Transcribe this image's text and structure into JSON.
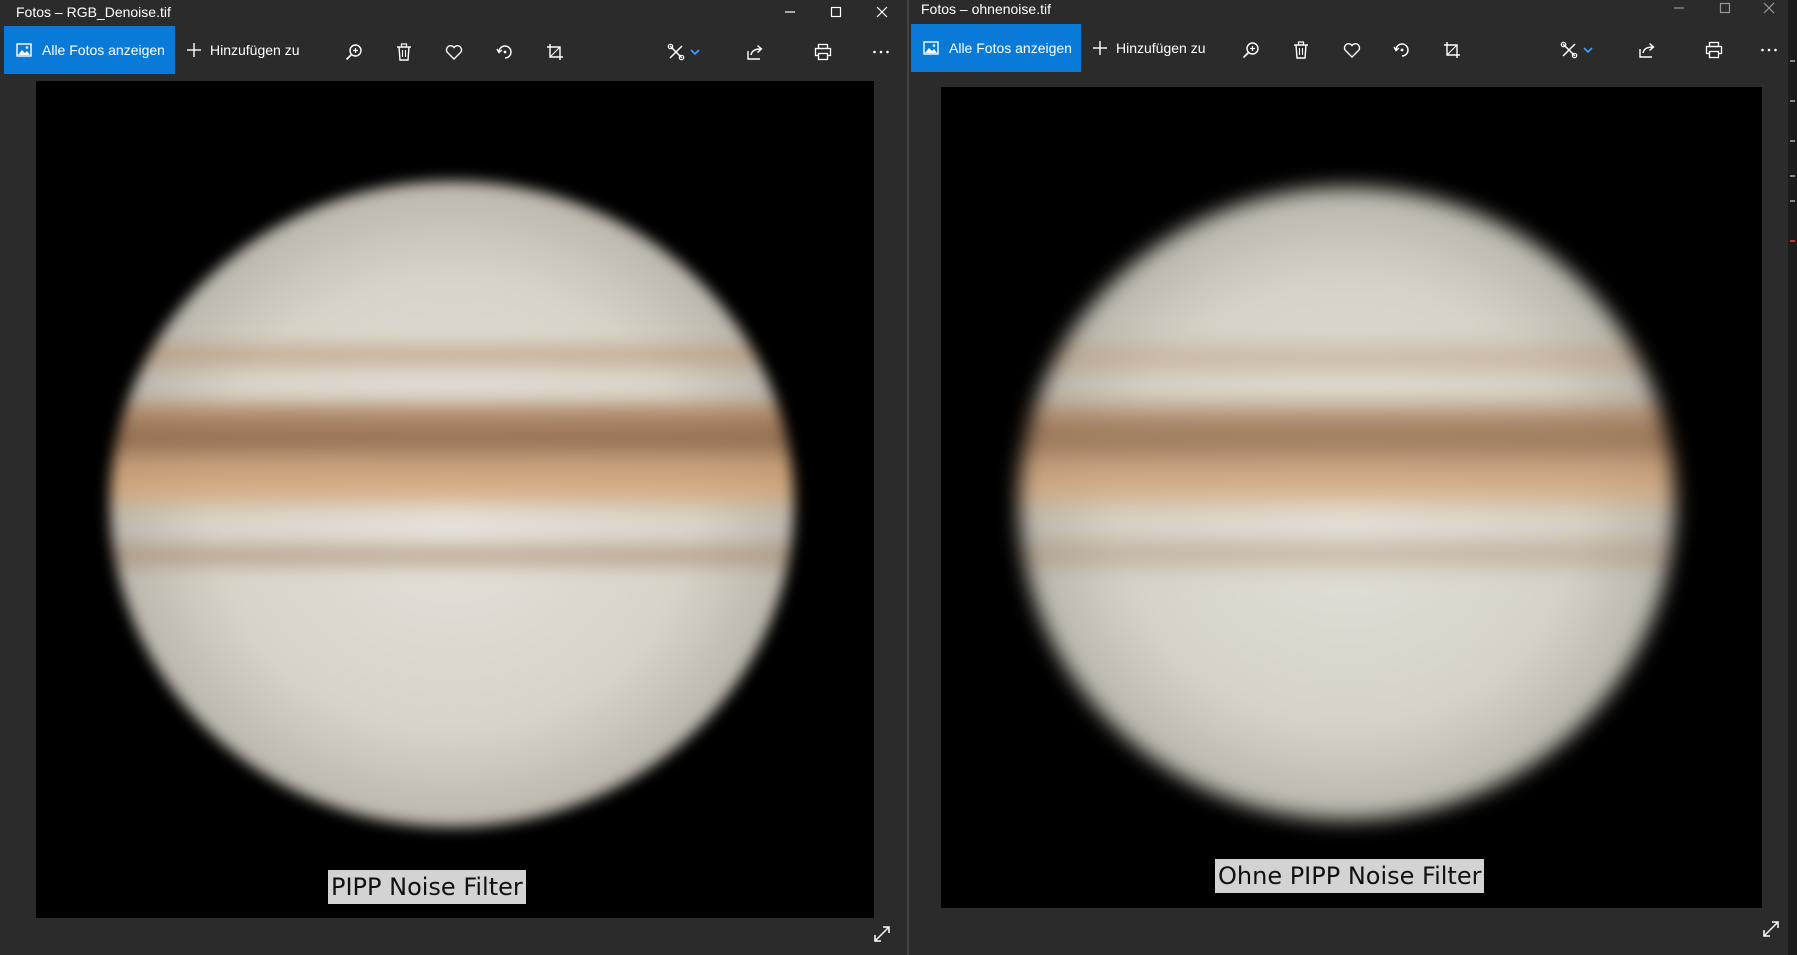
{
  "left_window": {
    "title": "Fotos – RGB_Denoise.tif",
    "show_all_label": "Alle Fotos anzeigen",
    "add_to_label": "Hinzufügen zu",
    "caption": "PIPP Noise Filter"
  },
  "right_window": {
    "title": "Fotos – ohnenoise.tif",
    "show_all_label": "Alle Fotos anzeigen",
    "add_to_label": "Hinzufügen zu",
    "caption": "Ohne PIPP Noise Filter"
  },
  "toolbar_icons": [
    "photos-icon",
    "plus-icon",
    "zoom-icon",
    "trash-icon",
    "heart-icon",
    "rotate-icon",
    "crop-icon",
    "edit-icon",
    "chevron-down-icon",
    "share-icon",
    "print-icon",
    "more-icon"
  ],
  "colors": {
    "accent": "#0a7ad8",
    "window_bg": "#2b2b2b",
    "viewer_bg": "#000000",
    "caption_bg": "#d3d3d3"
  }
}
